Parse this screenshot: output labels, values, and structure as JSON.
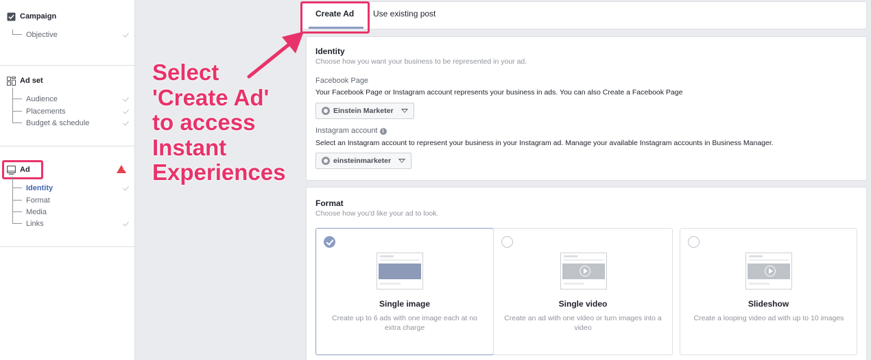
{
  "sidebar": {
    "campaign": {
      "title": "Campaign",
      "items": [
        {
          "label": "Objective",
          "done": true
        }
      ]
    },
    "adset": {
      "title": "Ad set",
      "items": [
        {
          "label": "Audience",
          "done": true
        },
        {
          "label": "Placements",
          "done": true
        },
        {
          "label": "Budget & schedule",
          "done": true
        }
      ]
    },
    "ad": {
      "title": "Ad",
      "warning": "!",
      "items": [
        {
          "label": "Identity",
          "done": true,
          "active": true
        },
        {
          "label": "Format",
          "done": false
        },
        {
          "label": "Media",
          "done": false
        },
        {
          "label": "Links",
          "done": true
        }
      ]
    }
  },
  "annotation": {
    "lines": [
      "Select",
      "'Create Ad'",
      "to access",
      "Instant",
      "Experiences"
    ],
    "color": "#e8336a"
  },
  "tabs": {
    "create": "Create Ad",
    "existing": "Use existing post",
    "active": "create"
  },
  "identity": {
    "title": "Identity",
    "description": "Choose how you want your business to be represented in your ad.",
    "facebook_page": {
      "label": "Facebook Page",
      "text": "Your Facebook Page or Instagram account represents your business in ads. You can also Create a Facebook Page",
      "selected": "Einstein Marketer"
    },
    "instagram": {
      "label": "Instagram account",
      "info_icon": "info-icon",
      "text": "Select an Instagram account to represent your business in your Instagram ad. Manage your available Instagram accounts in Business Manager.",
      "selected": "einsteinmarketer"
    }
  },
  "format": {
    "title": "Format",
    "description": "Choose how you'd like your ad to look.",
    "options": [
      {
        "title": "Single image",
        "description": "Create up to 6 ads with one image each at no extra charge",
        "selected": true
      },
      {
        "title": "Single video",
        "description": "Create an ad with one video or turn images into a video",
        "selected": false
      },
      {
        "title": "Slideshow",
        "description": "Create a looping video ad with up to 10 images",
        "selected": false
      }
    ]
  },
  "colors": {
    "accent": "#8b9dc3",
    "highlight": "#e8336a",
    "warning": "#e4424c",
    "link_active": "#4267b2"
  }
}
